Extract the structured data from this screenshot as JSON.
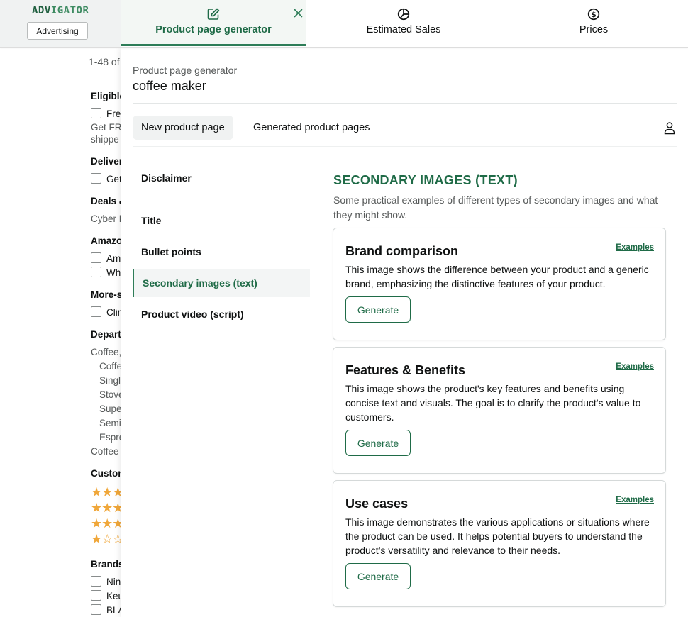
{
  "brand": {
    "logo_part1": "ADV",
    "logo_part2": "IGATOR",
    "advertising_button": "Advertising"
  },
  "tabs": [
    {
      "label": "Product page generator",
      "icon": "edit-icon",
      "active": true
    },
    {
      "label": "Estimated Sales",
      "icon": "pie-chart-icon",
      "active": false
    },
    {
      "label": "Prices",
      "icon": "dollar-circle-icon",
      "active": false
    }
  ],
  "background": {
    "results_text": "1-48 of",
    "filters": [
      {
        "text": "Eligible",
        "kind": "head"
      },
      {
        "text": "Free",
        "kind": "check"
      },
      {
        "text": "Get FR",
        "kind": "sub"
      },
      {
        "text": "shippe",
        "kind": "sub"
      },
      {
        "text": "Delivery",
        "kind": "head"
      },
      {
        "text": "Get",
        "kind": "check"
      },
      {
        "text": "Deals &",
        "kind": "head"
      },
      {
        "text": "Cyber M",
        "kind": "sub"
      },
      {
        "text": "Amazon",
        "kind": "head"
      },
      {
        "text": "Am",
        "kind": "check"
      },
      {
        "text": "Wh",
        "kind": "check"
      },
      {
        "text": "More-s",
        "kind": "head"
      },
      {
        "text": "Clim",
        "kind": "check"
      },
      {
        "text": "Depart",
        "kind": "head"
      },
      {
        "text": "Coffee,",
        "kind": "sub"
      },
      {
        "text": "Coffe",
        "kind": "indent"
      },
      {
        "text": "Singl",
        "kind": "indent"
      },
      {
        "text": "Stove",
        "kind": "indent"
      },
      {
        "text": "Supe",
        "kind": "indent"
      },
      {
        "text": "Semi",
        "kind": "indent"
      },
      {
        "text": "Espre",
        "kind": "indent"
      },
      {
        "text": "Coffee",
        "kind": "sub"
      },
      {
        "text": "Custom",
        "kind": "head"
      },
      {
        "text": "★★★",
        "kind": "stars"
      },
      {
        "text": "★★★",
        "kind": "stars"
      },
      {
        "text": "★★★",
        "kind": "stars"
      },
      {
        "text": "★☆☆",
        "kind": "stars"
      },
      {
        "text": "Brands",
        "kind": "head"
      },
      {
        "text": "Nin",
        "kind": "check"
      },
      {
        "text": "Keu",
        "kind": "check"
      },
      {
        "text": "BLA",
        "kind": "check"
      }
    ]
  },
  "panel": {
    "breadcrumb": "Product page generator",
    "product_name": "coffee maker",
    "subtabs": [
      {
        "label": "New product page",
        "active": true
      },
      {
        "label": "Generated product pages",
        "active": false
      }
    ],
    "nav": [
      {
        "label": "Disclaimer",
        "active": false
      },
      {
        "label": "Title",
        "active": false
      },
      {
        "label": "Bullet points",
        "active": false
      },
      {
        "label": "Secondary images (text)",
        "active": true
      },
      {
        "label": "Product video (script)",
        "active": false
      }
    ],
    "section_title": "SECONDARY IMAGES (TEXT)",
    "section_description": "Some practical examples of different types of secondary images and what they might show.",
    "cards": [
      {
        "title": "Brand comparison",
        "link": "Examples",
        "text": "This image shows the difference between your product and a generic brand, emphasizing the distinctive features of your product.",
        "button": "Generate"
      },
      {
        "title": "Features & Benefits",
        "link": "Examples",
        "text": "This image shows the product's key features and benefits using concise text and visuals. The goal is to clarify the product's value to customers.",
        "button": "Generate"
      },
      {
        "title": "Use cases",
        "link": "Examples",
        "text": "This image demonstrates the various applications or situations where the product can be used. It helps potential buyers to understand the product's versatility and relevance to their needs.",
        "button": "Generate"
      }
    ]
  },
  "colors": {
    "accent": "#1f6b47",
    "star": "#f0a73a",
    "text": "#0f1111",
    "muted": "#565959"
  }
}
